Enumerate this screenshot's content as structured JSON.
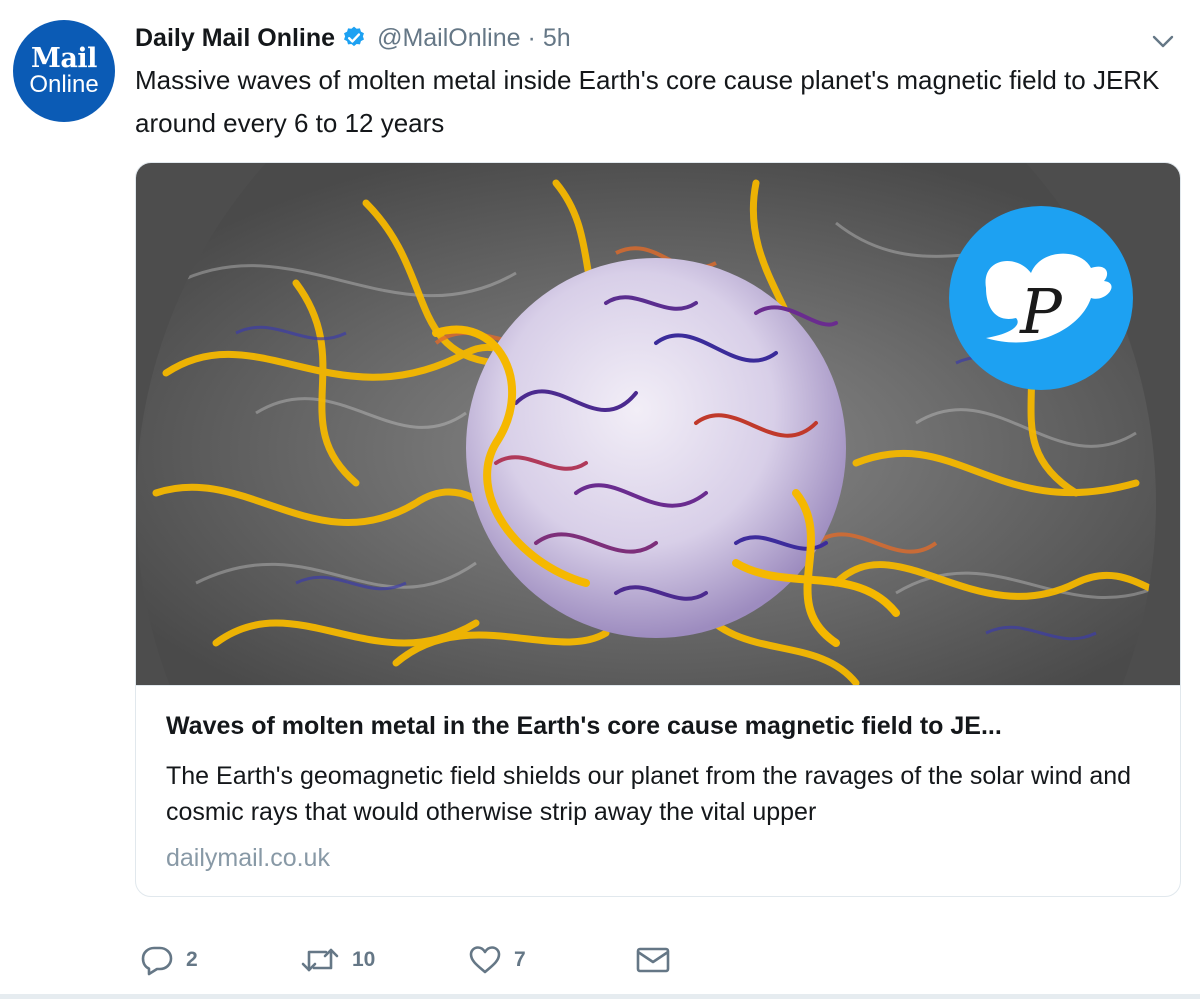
{
  "tweet": {
    "avatar": {
      "line1": "Mail",
      "line2": "Online",
      "color": "#0b5bb5"
    },
    "display_name": "Daily Mail Online",
    "handle": "@MailOnline",
    "separator": "·",
    "time": "5h",
    "text": "Massive waves of molten metal inside Earth's core cause planet's magnetic field to JERK around every 6 to 12 years"
  },
  "card": {
    "title": "Waves of molten metal in the Earth's core cause magnetic field to JE...",
    "description": "The Earth's geomagnetic field shields our planet from the ravages of the solar wind and cosmic rays that would otherwise strip away the vital upper",
    "domain": "dailymail.co.uk"
  },
  "actions": {
    "reply_count": "2",
    "retweet_count": "10",
    "like_count": "7"
  },
  "colors": {
    "verified": "#1da1f2",
    "muted": "#657786",
    "twitter_blue": "#1da1f2"
  }
}
